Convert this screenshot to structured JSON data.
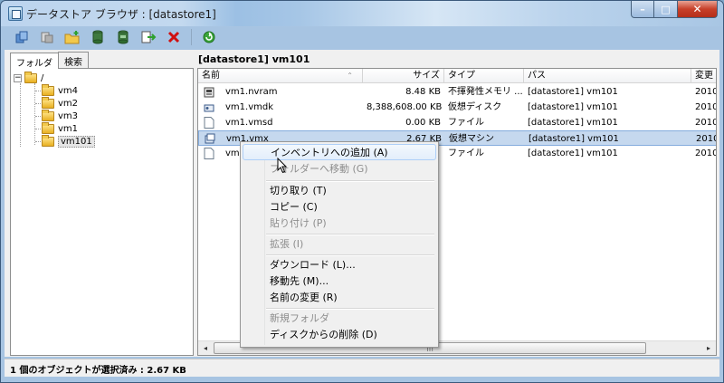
{
  "window": {
    "title": "データストア ブラウザ : [datastore1]",
    "buttons": {
      "minimize": "–",
      "maximize": "□",
      "close": "✕"
    }
  },
  "toolbar": {
    "icons": [
      "upload-icon",
      "download-icon",
      "new-folder-icon",
      "datastore-icon",
      "datastore-refresh-icon",
      "move-icon",
      "delete-icon",
      "refresh-icon"
    ]
  },
  "left_panel": {
    "tabs": [
      "フォルダ",
      "検索"
    ],
    "tree": {
      "root": "/",
      "children": [
        "vm4",
        "vm2",
        "vm3",
        "vm1",
        "vm101"
      ]
    }
  },
  "right_panel": {
    "path": "[datastore1] vm101",
    "columns": [
      "名前",
      "サイズ",
      "タイプ",
      "パス",
      "変更"
    ],
    "rows": [
      {
        "name": "vm1.nvram",
        "size": "8.48 KB",
        "type": "不揮発性メモリ ...",
        "path": "[datastore1] vm101",
        "modified": "2010/0",
        "icon": "nvram-icon"
      },
      {
        "name": "vm1.vmdk",
        "size": "8,388,608.00 KB",
        "type": "仮想ディスク",
        "path": "[datastore1] vm101",
        "modified": "2010/0",
        "icon": "virtual-disk-icon"
      },
      {
        "name": "vm1.vmsd",
        "size": "0.00 KB",
        "type": "ファイル",
        "path": "[datastore1] vm101",
        "modified": "2010/0",
        "icon": "file-icon"
      },
      {
        "name": "vm1.vmx",
        "size": "2.67 KB",
        "type": "仮想マシン",
        "path": "[datastore1] vm101",
        "modified": "2010/0",
        "icon": "virtual-machine-icon"
      },
      {
        "name": "vm",
        "size": "",
        "type": "ファイル",
        "path": "[datastore1] vm101",
        "modified": "2010/0",
        "icon": "file-icon"
      }
    ],
    "selected_row": 3
  },
  "context_menu": {
    "items": [
      {
        "label": "インベントリへの追加 (A)",
        "enabled": true,
        "highlighted": true
      },
      {
        "label": "フォルダーへ移動 (G)",
        "enabled": false
      },
      {
        "label": "切り取り (T)",
        "enabled": true
      },
      {
        "label": "コピー (C)",
        "enabled": true
      },
      {
        "label": "貼り付け (P)",
        "enabled": false
      },
      {
        "label": "拡張 (I)",
        "enabled": false
      },
      {
        "label": "ダウンロード (L)...",
        "enabled": true
      },
      {
        "label": "移動先 (M)...",
        "enabled": true
      },
      {
        "label": "名前の変更 (R)",
        "enabled": true
      },
      {
        "label": "新規フォルダ",
        "enabled": false
      },
      {
        "label": "ディスクからの削除 (D)",
        "enabled": true
      }
    ]
  },
  "statusbar": {
    "text": "1 個のオブジェクトが選択済み : 2.67 KB"
  },
  "colors": {
    "selection": "#c5d8ee",
    "delete": "#d01010",
    "refresh": "#3aa53a",
    "folder": "#f2c94c"
  }
}
